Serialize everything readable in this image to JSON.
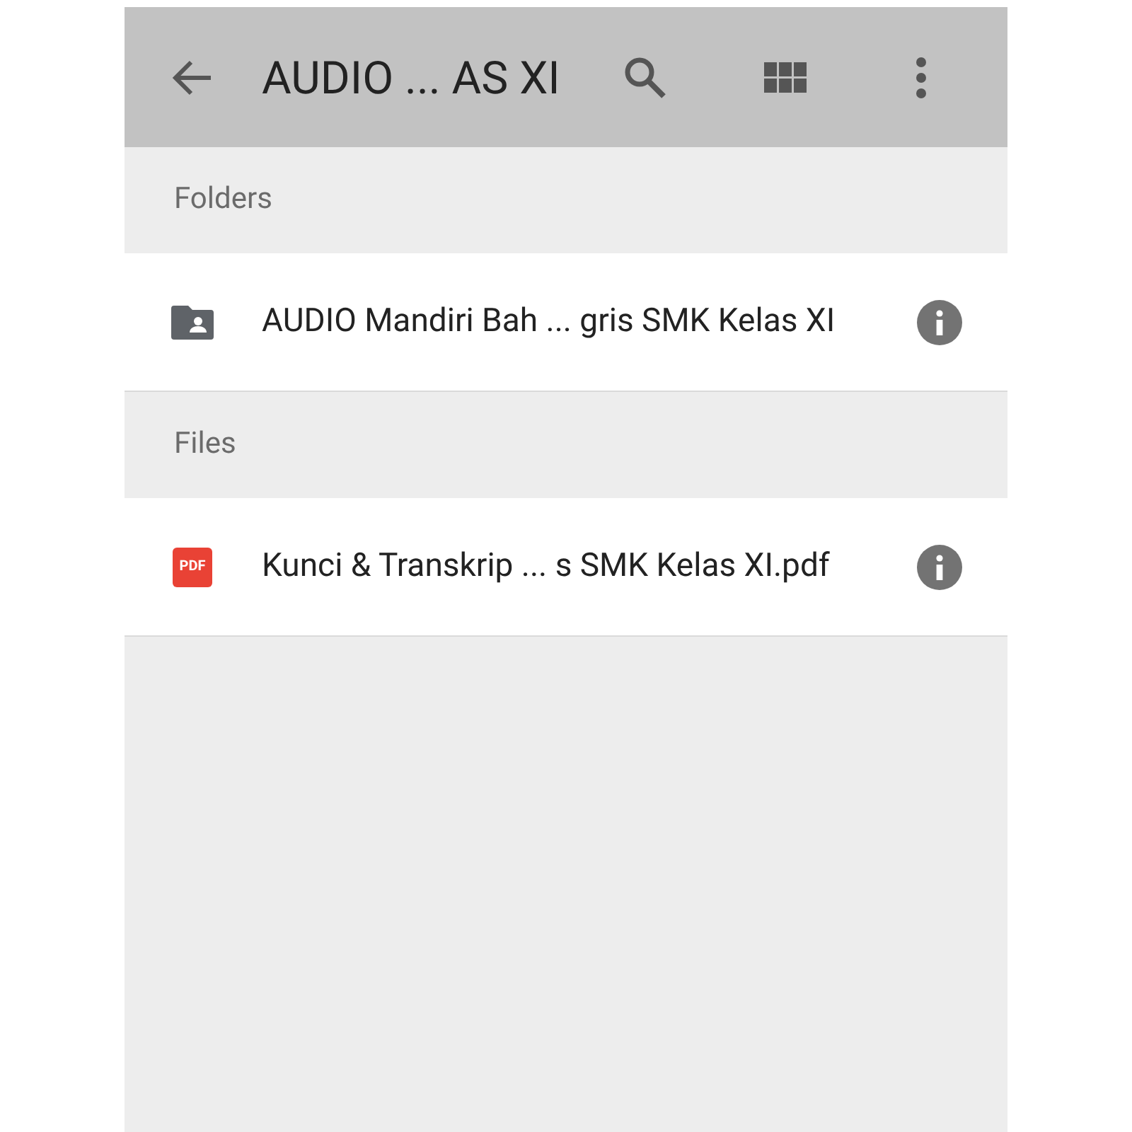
{
  "toolbar": {
    "title": "AUDIO ... AS XI"
  },
  "sections": [
    {
      "heading": "Folders",
      "items": [
        {
          "kind": "folder",
          "name": "AUDIO Mandiri Bah ... gris SMK Kelas XI"
        }
      ]
    },
    {
      "heading": "Files",
      "items": [
        {
          "kind": "pdf",
          "name": "Kunci & Transkrip ... s SMK Kelas XI.pdf",
          "badge": "PDF"
        }
      ]
    }
  ]
}
